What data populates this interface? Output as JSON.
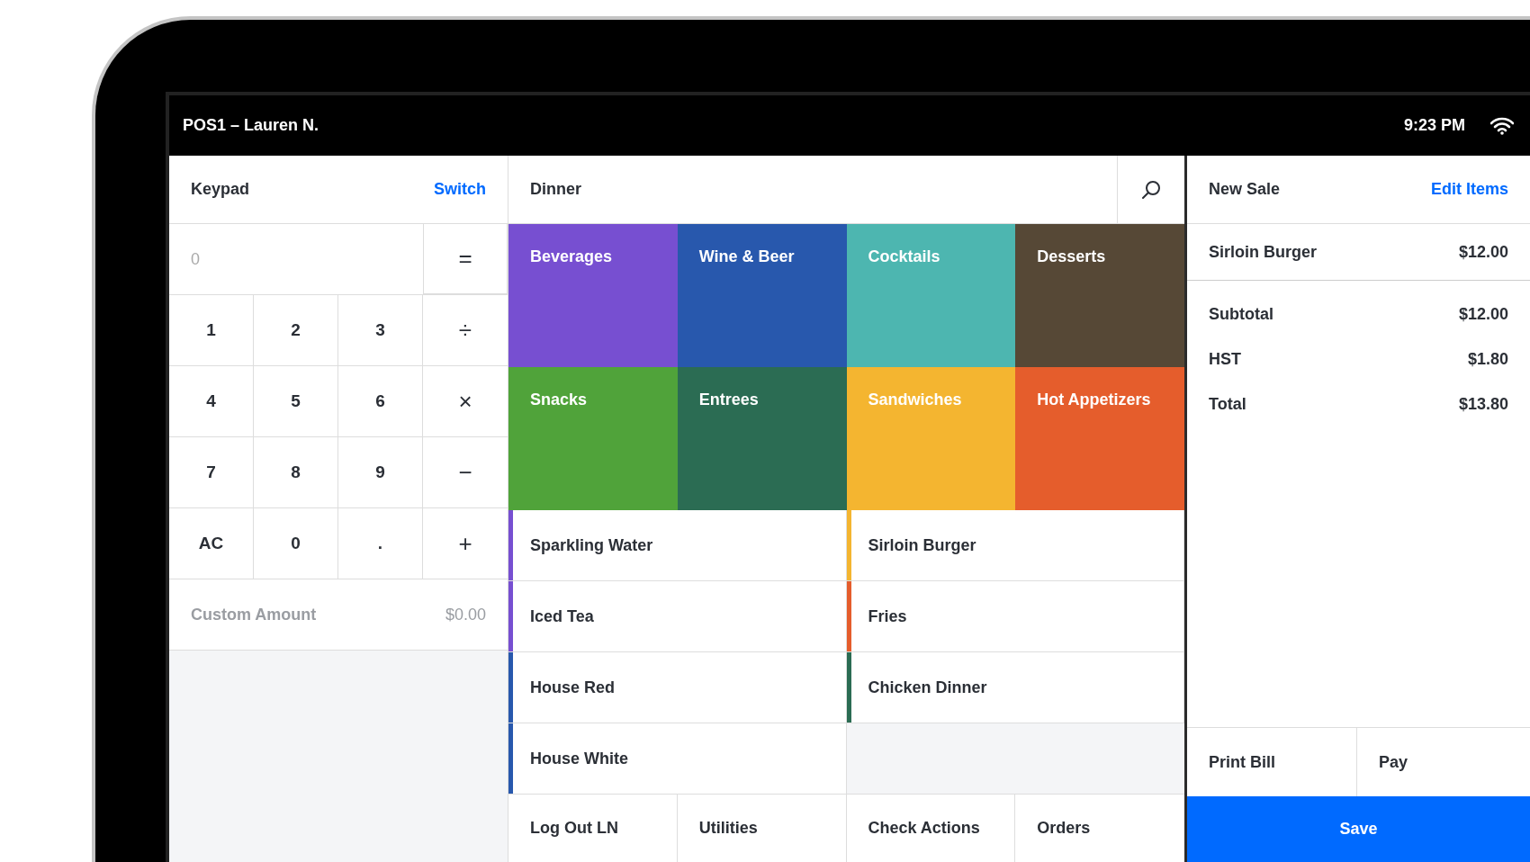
{
  "status_bar": {
    "title": "POS1 – Lauren N.",
    "time": "9:23 PM"
  },
  "keypad": {
    "title": "Keypad",
    "switch": "Switch",
    "display_placeholder": "0",
    "equals": "=",
    "keys": [
      {
        "label": "1",
        "kind": "digit"
      },
      {
        "label": "2",
        "kind": "digit"
      },
      {
        "label": "3",
        "kind": "digit"
      },
      {
        "label": "÷",
        "kind": "operator"
      },
      {
        "label": "4",
        "kind": "digit"
      },
      {
        "label": "5",
        "kind": "digit"
      },
      {
        "label": "6",
        "kind": "digit"
      },
      {
        "label": "×",
        "kind": "operator"
      },
      {
        "label": "7",
        "kind": "digit"
      },
      {
        "label": "8",
        "kind": "digit"
      },
      {
        "label": "9",
        "kind": "digit"
      },
      {
        "label": "−",
        "kind": "operator"
      },
      {
        "label": "AC",
        "kind": "digit"
      },
      {
        "label": "0",
        "kind": "digit"
      },
      {
        "label": ".",
        "kind": "digit"
      },
      {
        "label": "+",
        "kind": "operator"
      }
    ],
    "custom_amount": {
      "label": "Custom Amount",
      "value": "$0.00"
    }
  },
  "menu": {
    "title": "Dinner",
    "categories": [
      {
        "label": "Beverages",
        "color": "#774fd1"
      },
      {
        "label": "Wine & Beer",
        "color": "#2858ad"
      },
      {
        "label": "Cocktails",
        "color": "#4db6b0"
      },
      {
        "label": "Desserts",
        "color": "#564836"
      },
      {
        "label": "Snacks",
        "color": "#50a33a"
      },
      {
        "label": "Entrees",
        "color": "#2b6c53"
      },
      {
        "label": "Sandwiches",
        "color": "#f4b530"
      },
      {
        "label": "Hot Appetizers",
        "color": "#e55d2c"
      }
    ],
    "items": [
      {
        "label": "Sparkling Water",
        "color": "#774fd1"
      },
      {
        "label": "Sirloin Burger",
        "color": "#f4b530"
      },
      {
        "label": "Iced Tea",
        "color": "#774fd1"
      },
      {
        "label": "Fries",
        "color": "#e55d2c"
      },
      {
        "label": "House Red",
        "color": "#2858ad"
      },
      {
        "label": "Chicken Dinner",
        "color": "#2b6c53"
      },
      {
        "label": "House White",
        "color": "#2858ad"
      }
    ],
    "actions": [
      "Log Out LN",
      "Utilities",
      "Check Actions",
      "Orders"
    ]
  },
  "sale": {
    "title": "New Sale",
    "edit": "Edit Items",
    "lines": [
      {
        "name": "Sirloin Burger",
        "price": "$12.00"
      }
    ],
    "totals": [
      {
        "label": "Subtotal",
        "value": "$12.00"
      },
      {
        "label": "HST",
        "value": "$1.80"
      },
      {
        "label": "Total",
        "value": "$13.80"
      }
    ],
    "buttons": [
      "Print Bill",
      "Pay"
    ],
    "save": "Save"
  }
}
